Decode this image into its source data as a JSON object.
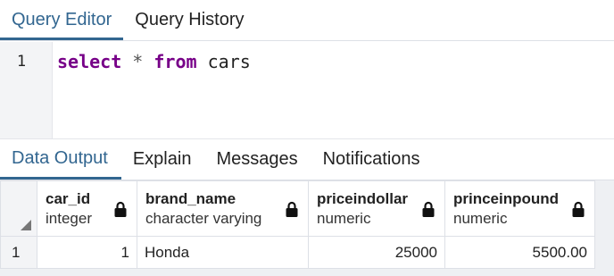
{
  "top_tabs": [
    {
      "label": "Query Editor",
      "active": true
    },
    {
      "label": "Query History",
      "active": false
    }
  ],
  "editor": {
    "line_number": "1",
    "tokens": {
      "select": "select",
      "star": "*",
      "from": "from",
      "table": "cars"
    }
  },
  "output_tabs": [
    {
      "label": "Data Output",
      "active": true
    },
    {
      "label": "Explain",
      "active": false
    },
    {
      "label": "Messages",
      "active": false
    },
    {
      "label": "Notifications",
      "active": false
    }
  ],
  "grid": {
    "columns": [
      {
        "name": "car_id",
        "type": "integer",
        "icon": "lock-icon"
      },
      {
        "name": "brand_name",
        "type": "character varying",
        "icon": "lock-icon"
      },
      {
        "name": "priceindollar",
        "type": "numeric",
        "icon": "lock-icon"
      },
      {
        "name": "princeinpound",
        "type": "numeric",
        "icon": "lock-icon"
      }
    ],
    "rows": [
      {
        "row_number": "1",
        "cells": [
          "1",
          "Honda",
          "25000",
          "5500.00"
        ]
      }
    ]
  },
  "colors": {
    "accent": "#326690",
    "keyword": "#770088"
  }
}
